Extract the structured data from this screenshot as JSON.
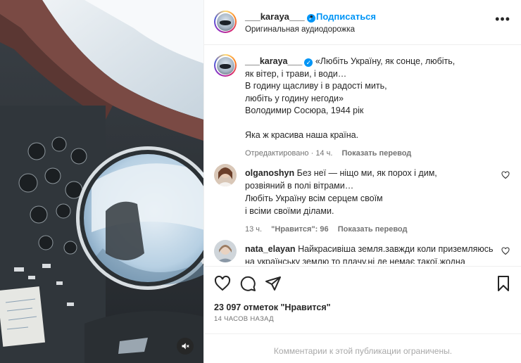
{
  "post_header": {
    "username": "___karaya___",
    "separator": "•",
    "follow_label": "Подписаться",
    "audio_label": "Оригинальная аудиодорожка",
    "more_label": "•••"
  },
  "caption": {
    "username": "___karaya___",
    "lines": [
      "«Любіть Україну, як сонце, любіть,",
      "як вітер, і трави, і води…",
      "В годину щасливу і в радості мить,",
      "любіть у годину негоди»",
      "Володимир Сосюра, 1944 рік",
      "",
      "Яка ж красива наша країна."
    ],
    "edited": "Отредактировано",
    "dot": "·",
    "time": "14 ч.",
    "translate": "Показать перевод"
  },
  "comments": [
    {
      "username": "olganoshyn",
      "lines": [
        "Без неї — ніщо ми, як порох і дим,",
        "розвіяний в полі вітрами…",
        "Любіть Україну всім серцем своїм",
        "і всіми своїми ділами."
      ],
      "time": "13 ч.",
      "likes": "\"Нравится\": 96",
      "translate": "Показать перевод"
    },
    {
      "username": "nata_elayan",
      "lines": [
        "Найкрасивіша земля.завжди коли приземляюсь",
        "на українську землю то плачу.ні де немає такої.жодна"
      ]
    }
  ],
  "likes_text": "23 097 отметок \"Нравится\"",
  "time_ago": "14 ЧАСОВ НАЗАД",
  "comments_restricted": "Комментарии к этой публикации ограничены.",
  "icons": {
    "verified": "verified-badge-icon",
    "like": "heart-icon",
    "comment": "comment-icon",
    "share": "paper-plane-icon",
    "save": "bookmark-icon",
    "mute": "speaker-muted-icon"
  },
  "colors": {
    "accent": "#0095f6",
    "text": "#262626",
    "muted": "#737373",
    "border": "#efefef"
  }
}
